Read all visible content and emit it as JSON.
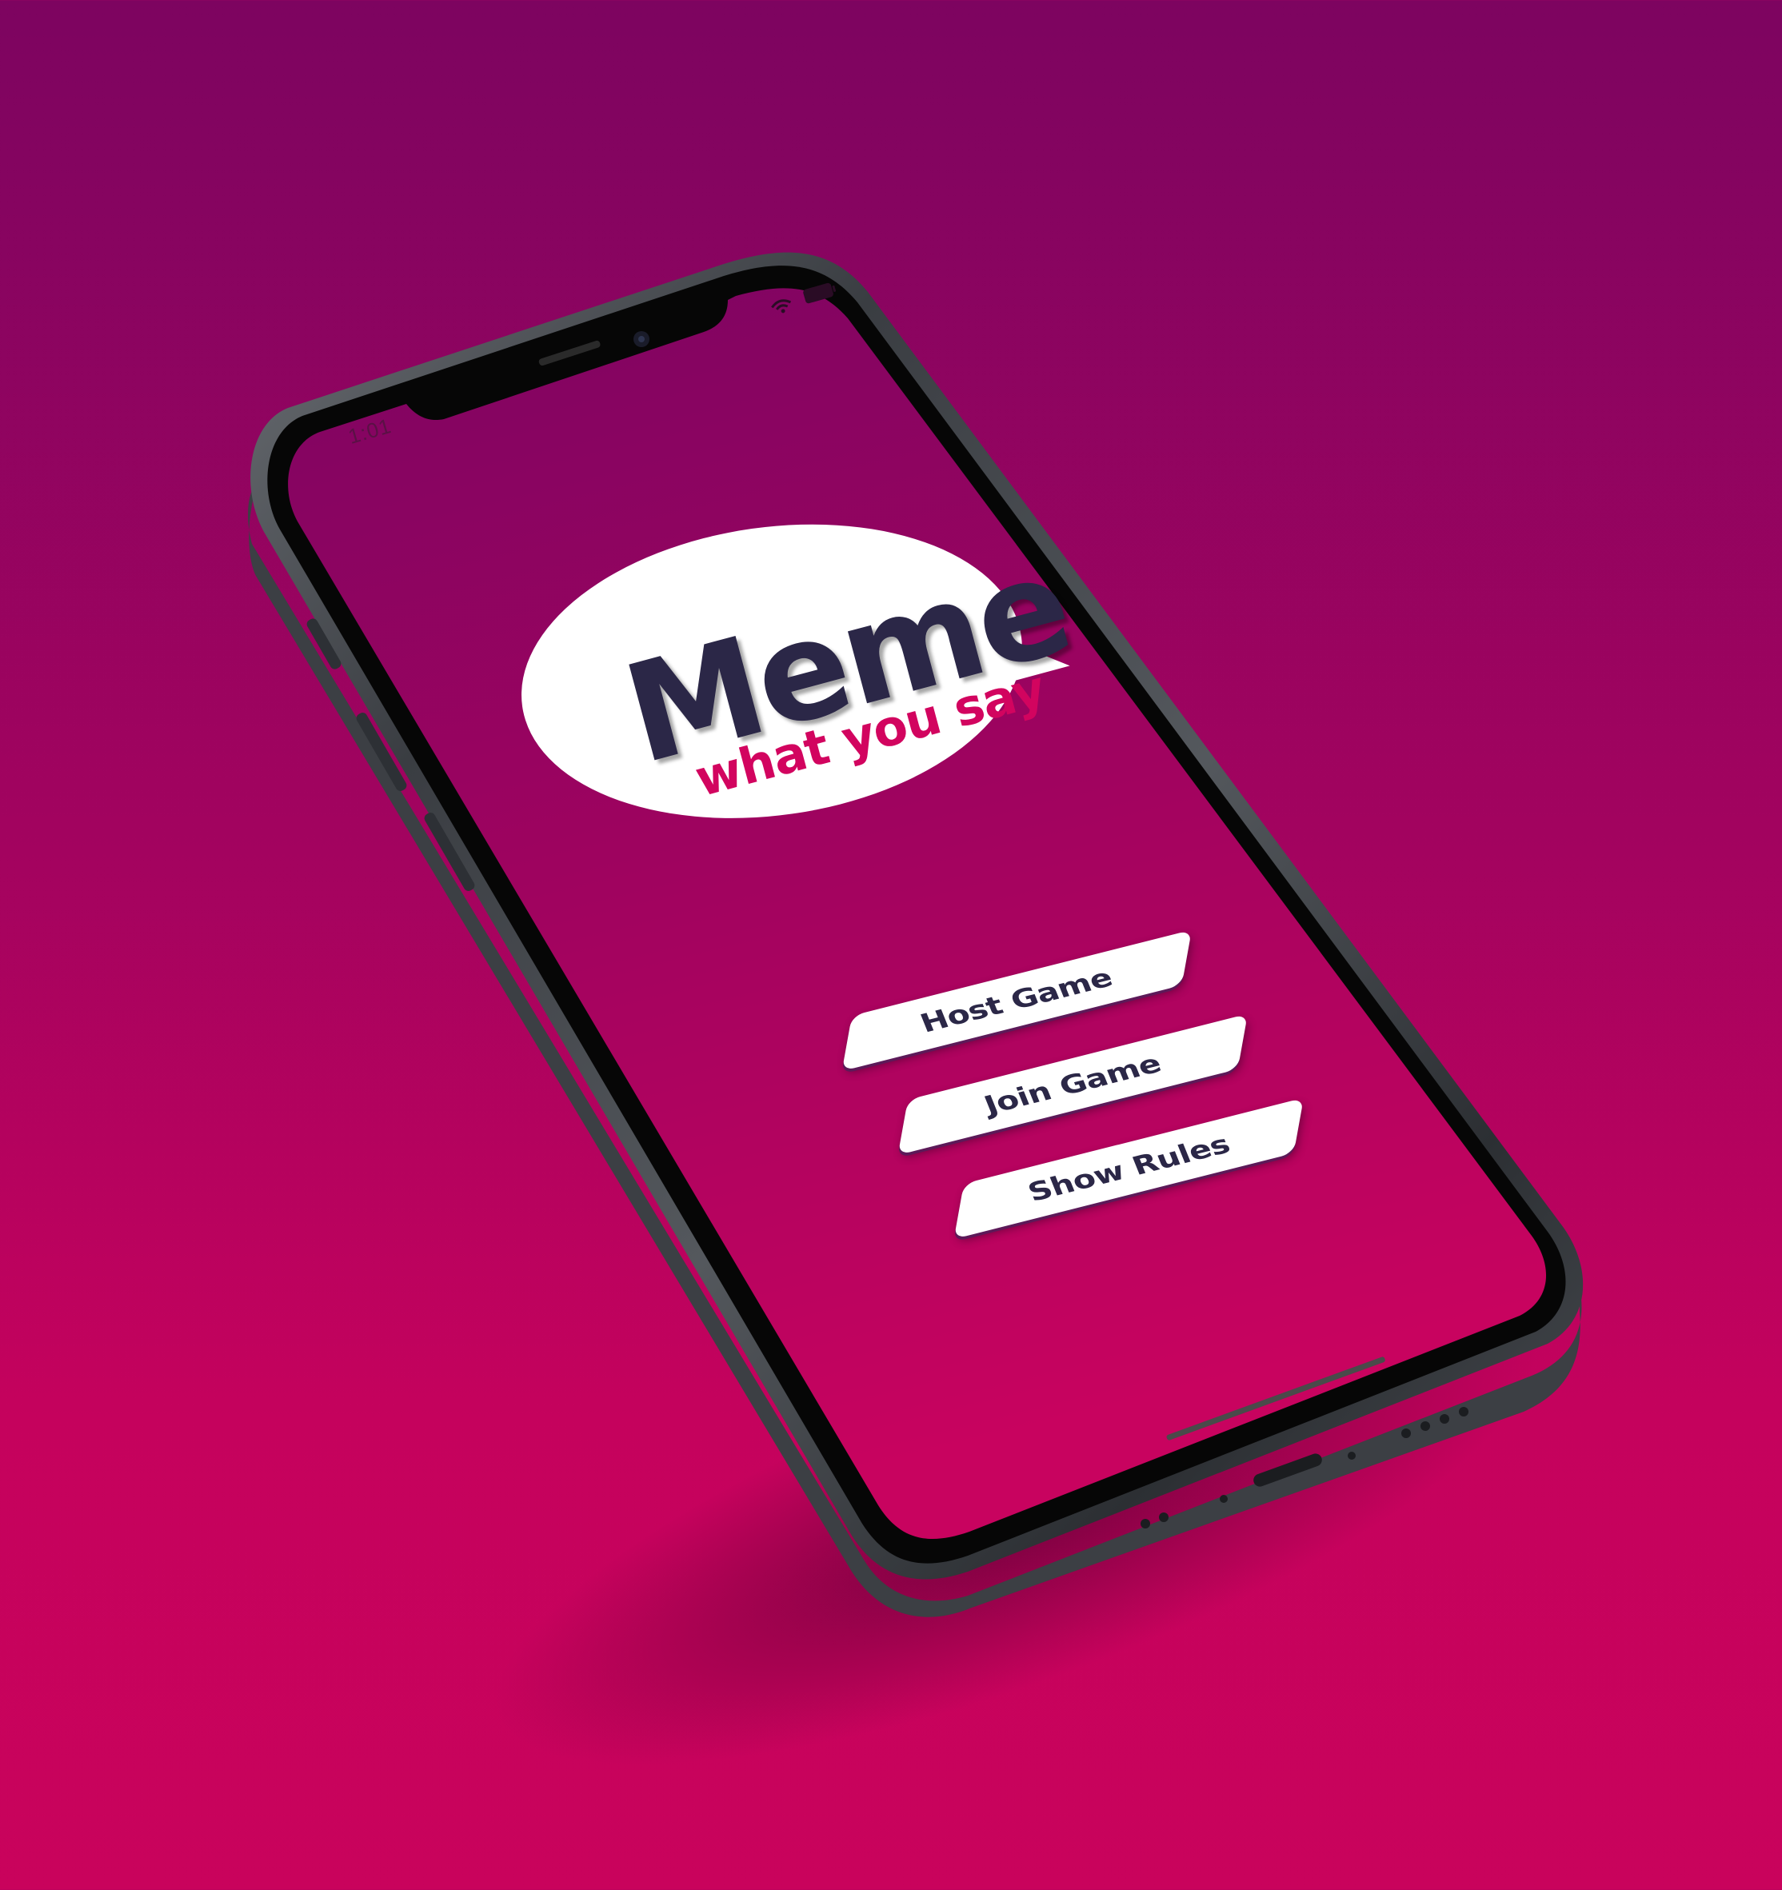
{
  "status_bar": {
    "time": "1:01",
    "wifi_icon": "wifi-icon",
    "battery_icon": "battery-icon"
  },
  "logo": {
    "title": "Meme",
    "subtitle": "what you say",
    "title_color": "#2b2747",
    "subtitle_color": "#d2045f"
  },
  "menu": {
    "host_label": "Host Game",
    "join_label": "Join Game",
    "rules_label": "Show Rules"
  },
  "colors": {
    "background_top": "#7d0460",
    "background_bottom": "#c9035c",
    "button_text": "#2b2747",
    "button_bg": "#ffffff"
  }
}
